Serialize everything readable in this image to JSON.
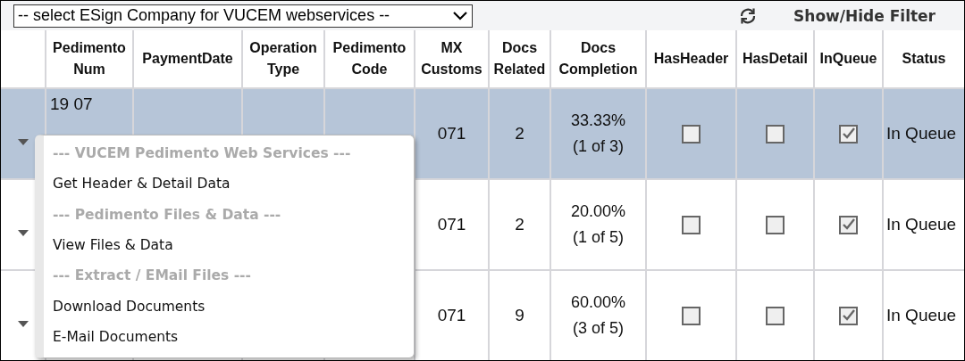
{
  "toolbar": {
    "company_select": "-- select ESign Company for VUCEM webservices --",
    "filter_button": "Show/Hide Filter"
  },
  "table": {
    "columns": [
      "Pedimento Num",
      "PaymentDate",
      "Operation Type",
      "Pedimento Code",
      "MX Customs",
      "Docs Related",
      "Docs Completion",
      "HasHeader",
      "HasDetail",
      "InQueue",
      "Status"
    ],
    "rows": [
      {
        "selected": true,
        "pedimento_num": "19 07",
        "mx_customs": "071",
        "docs_related": "2",
        "docs_completion": "33.33%",
        "docs_count": "(1 of 3)",
        "has_header": false,
        "has_detail": false,
        "in_queue": true,
        "status": "In Queue"
      },
      {
        "selected": false,
        "mx_customs": "071",
        "docs_related": "2",
        "docs_completion": "20.00%",
        "docs_count": "(1 of 5)",
        "has_header": false,
        "has_detail": false,
        "in_queue": true,
        "status": "In Queue"
      },
      {
        "selected": false,
        "mx_customs": "071",
        "docs_related": "9",
        "docs_completion": "60.00%",
        "docs_count": "(3 of 5)",
        "has_header": false,
        "has_detail": false,
        "in_queue": true,
        "status": "In Queue"
      }
    ]
  },
  "context_menu": {
    "items": [
      {
        "kind": "heading",
        "label": "--- VUCEM Pedimento Web Services ---"
      },
      {
        "kind": "action",
        "label": "Get Header & Detail Data"
      },
      {
        "kind": "heading",
        "label": "--- Pedimento Files & Data ---"
      },
      {
        "kind": "action",
        "label": "View Files & Data"
      },
      {
        "kind": "heading",
        "label": "--- Extract / EMail Files ---"
      },
      {
        "kind": "action",
        "label": "Download Documents"
      },
      {
        "kind": "action",
        "label": "E-Mail Documents"
      }
    ]
  }
}
